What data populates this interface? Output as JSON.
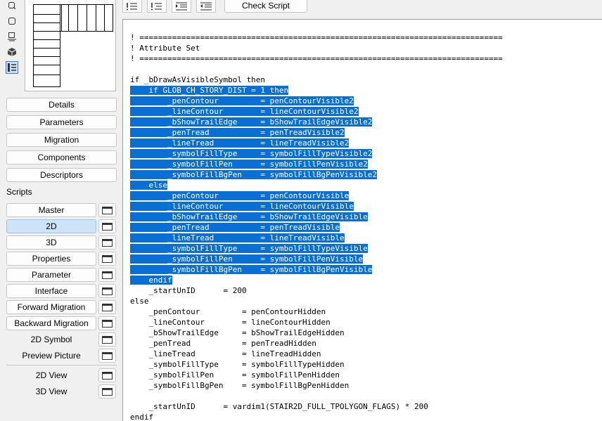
{
  "sidebar": {
    "tool_icons": [
      "select-icon",
      "square-icon",
      "stamp-icon",
      "cube-icon",
      "list-view-icon"
    ],
    "buttons": [
      "Details",
      "Parameters",
      "Migration",
      "Components",
      "Descriptors"
    ],
    "scripts_heading": "Scripts",
    "scripts": [
      {
        "label": "Master",
        "selected": false
      },
      {
        "label": "2D",
        "selected": true
      },
      {
        "label": "3D",
        "selected": false
      },
      {
        "label": "Properties",
        "selected": false
      },
      {
        "label": "Parameter",
        "selected": false
      },
      {
        "label": "Interface",
        "selected": false
      },
      {
        "label": "Forward Migration",
        "selected": false
      },
      {
        "label": "Backward Migration",
        "selected": false
      }
    ],
    "extras": [
      "2D Symbol",
      "Preview Picture"
    ],
    "views": [
      "2D View",
      "3D View"
    ]
  },
  "toolbar": {
    "icons": [
      "list-format-icon",
      "numbered-list-icon",
      "indent-icon",
      "outdent-icon"
    ],
    "check_script": "Check Script"
  },
  "editor": {
    "selection_color": "#0a6fd5",
    "lines": [
      {
        "text": "! ==============================================================================",
        "sel": false
      },
      {
        "text": "! Attribute Set",
        "sel": false
      },
      {
        "text": "! ==============================================================================",
        "sel": false
      },
      {
        "text": "",
        "sel": false
      },
      {
        "text": "if _bDrawAsVisibleSymbol then",
        "sel": false
      },
      {
        "text": "    if GLOB_CH_STORY_DIST = 1 then",
        "sel": true
      },
      {
        "text": "        _penContour         = penContourVisible2",
        "sel": true
      },
      {
        "text": "        _lineContour        = lineContourVisible2",
        "sel": true
      },
      {
        "text": "        _bShowTrailEdge     = bShowTrailEdgeVisible2",
        "sel": true
      },
      {
        "text": "        _penTread           = penTreadVisible2",
        "sel": true
      },
      {
        "text": "        _lineTread          = lineTreadVisible2",
        "sel": true
      },
      {
        "text": "        _symbolFillType     = symbolFillTypeVisible2",
        "sel": true
      },
      {
        "text": "        _symbolFillPen      = symbolFillPenVisible2",
        "sel": true
      },
      {
        "text": "        _symbolFillBgPen    = symbolFillBgPenVisible2",
        "sel": true
      },
      {
        "text": "    else",
        "sel": true
      },
      {
        "text": "        _penContour         = penContourVisible",
        "sel": true
      },
      {
        "text": "        _lineContour        = lineContourVisible",
        "sel": true
      },
      {
        "text": "        _bShowTrailEdge     = bShowTrailEdgeVisible",
        "sel": true
      },
      {
        "text": "        _penTread           = penTreadVisible",
        "sel": true
      },
      {
        "text": "        _lineTread          = lineTreadVisible",
        "sel": true
      },
      {
        "text": "        _symbolFillType     = symbolFillTypeVisible",
        "sel": true
      },
      {
        "text": "        _symbolFillPen      = symbolFillPenVisible",
        "sel": true
      },
      {
        "text": "        _symbolFillBgPen    = symbolFillBgPenVisible",
        "sel": true
      },
      {
        "text": "    endif",
        "sel": true
      },
      {
        "text": "    _startUnID      = 200",
        "sel": false
      },
      {
        "text": "else",
        "sel": false
      },
      {
        "text": "    _penContour         = penContourHidden",
        "sel": false
      },
      {
        "text": "    _lineContour        = lineContourHidden",
        "sel": false
      },
      {
        "text": "    _bShowTrailEdge     = bShowTrailEdgeHidden",
        "sel": false
      },
      {
        "text": "    _penTread           = penTreadHidden",
        "sel": false
      },
      {
        "text": "    _lineTread          = lineTreadHidden",
        "sel": false
      },
      {
        "text": "    _symbolFillType     = symbolFillTypeHidden",
        "sel": false
      },
      {
        "text": "    _symbolFillPen      = symbolFillPenHidden",
        "sel": false
      },
      {
        "text": "    _symbolFillBgPen    = symbolFillBgPenHidden",
        "sel": false
      },
      {
        "text": "",
        "sel": false
      },
      {
        "text": "    _startUnID      = vardim1(STAIR2D_FULL_TPOLYGON_FLAGS) * 200",
        "sel": false
      },
      {
        "text": "endif",
        "sel": false
      }
    ]
  }
}
